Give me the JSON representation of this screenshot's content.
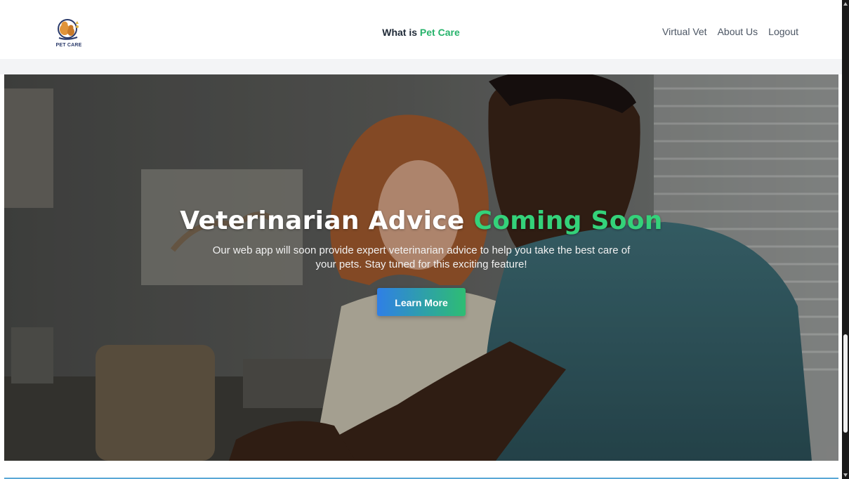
{
  "header": {
    "logo_text": "PET CARE",
    "center_prefix": "What is ",
    "center_accent": "Pet Care",
    "nav": [
      {
        "label": "Virtual Vet"
      },
      {
        "label": "About Us"
      },
      {
        "label": "Logout"
      }
    ]
  },
  "hero": {
    "title_main": "Veterinarian Advice ",
    "title_accent": "Coming Soon",
    "subtitle": "Our web app will soon provide expert veterinarian advice to help you take the best care of your pets. Stay tuned for this exciting feature!",
    "button_label": "Learn More"
  },
  "colors": {
    "accent_green": "#34d27a",
    "button_gradient_start": "#2f7fe6",
    "button_gradient_end": "#2ebd73"
  }
}
